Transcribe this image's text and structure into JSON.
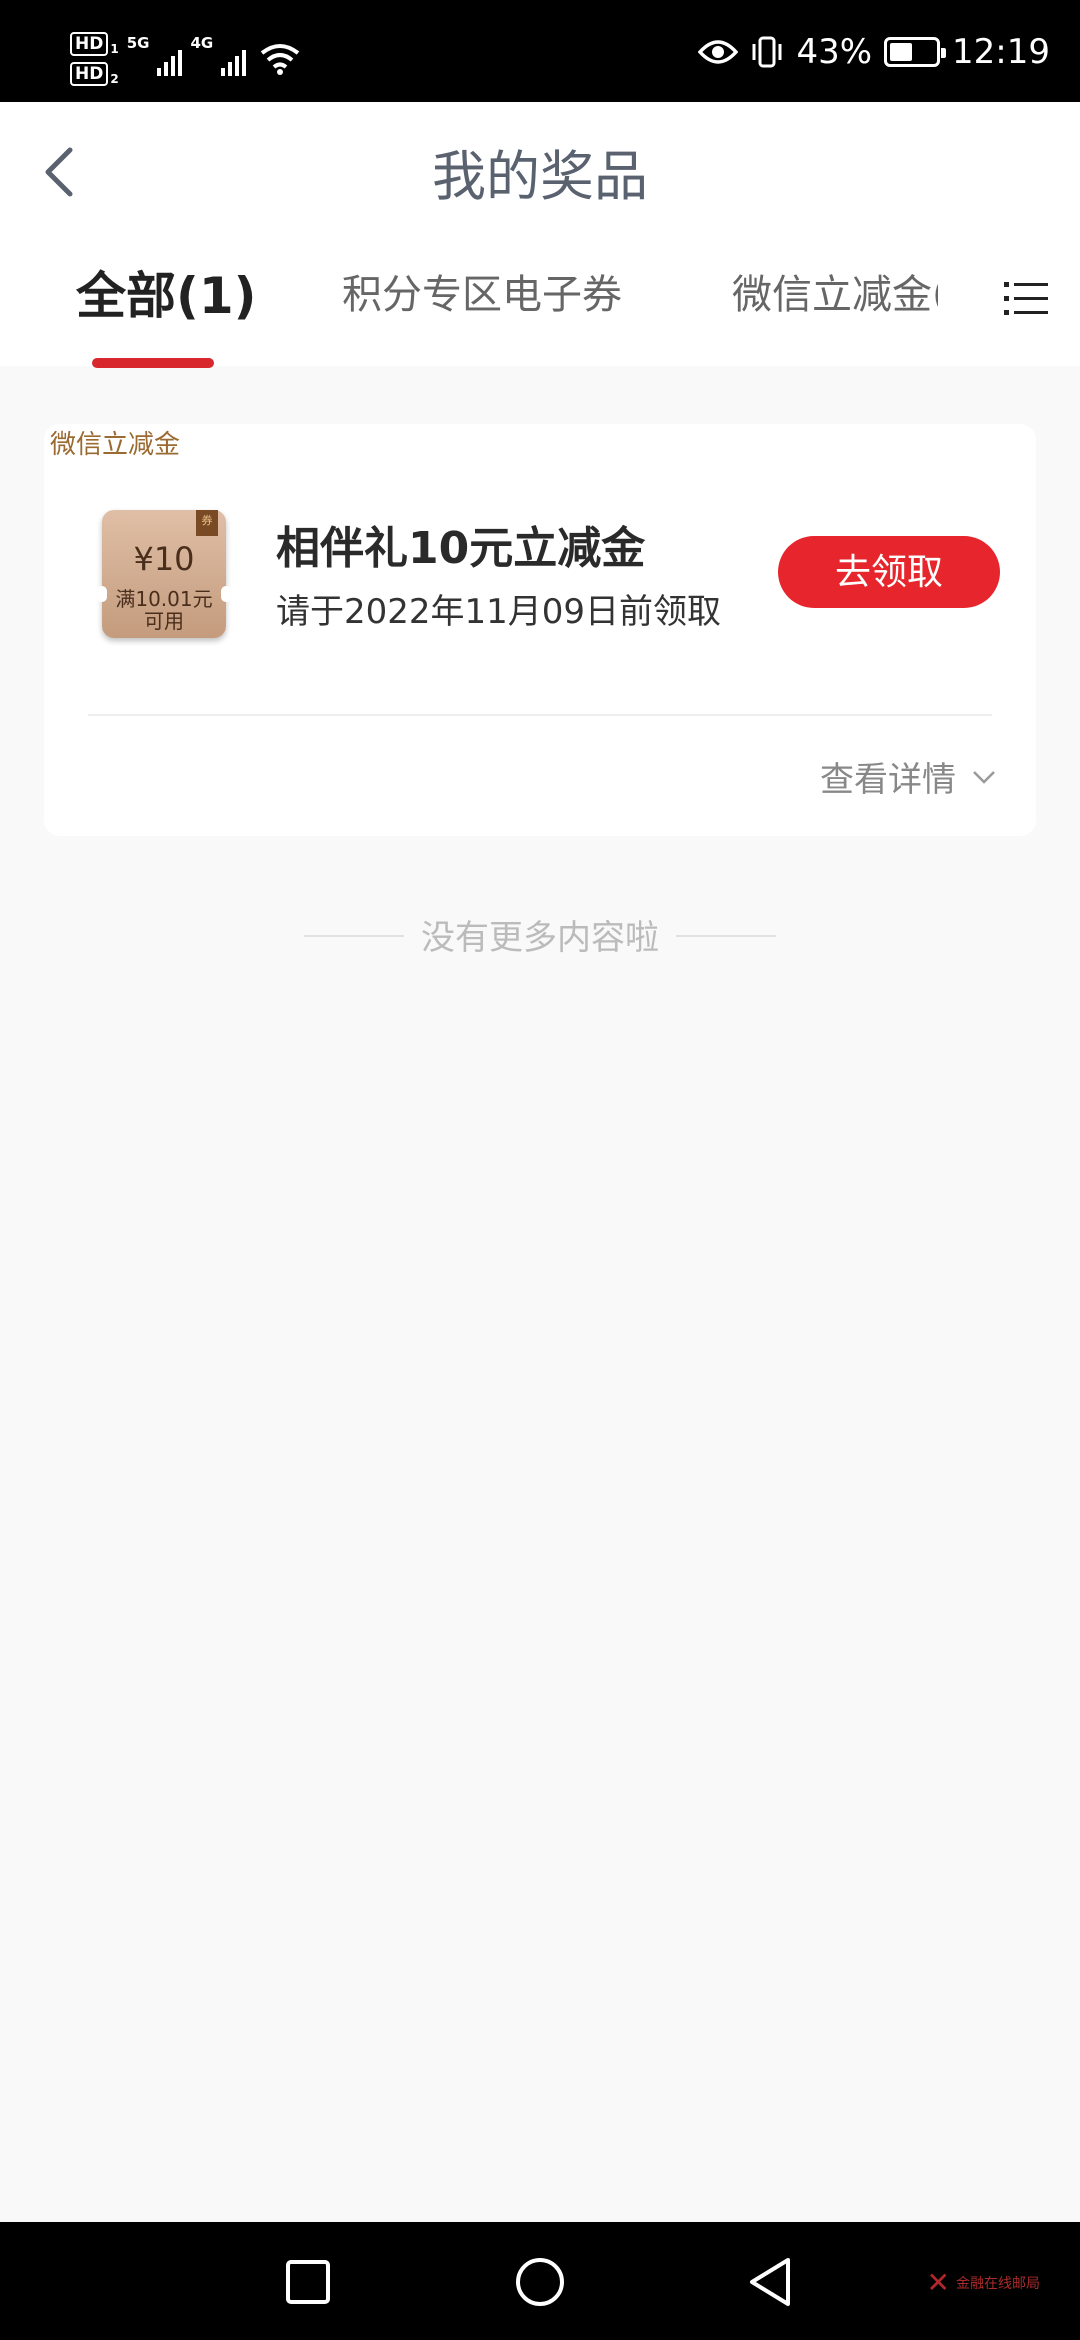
{
  "status_bar": {
    "hd1": "HD",
    "hd1_sub": "1",
    "hd2": "HD",
    "hd2_sub": "2",
    "net1": "5G",
    "net2": "4G",
    "battery_percent": "43%",
    "battery_level": 0.43,
    "time": "12:19",
    "icons": [
      "signal-icon",
      "wifi-icon",
      "eye-icon",
      "vibrate-icon",
      "battery-icon"
    ]
  },
  "header": {
    "title": "我的奖品",
    "back_icon": "chevron-left-icon",
    "menu_icon": "list-menu-icon"
  },
  "tabs": [
    {
      "label": "全部(1)",
      "active": true
    },
    {
      "label": "积分专区电子券",
      "active": false
    },
    {
      "label": "微信立减金(",
      "active": false
    }
  ],
  "prize_card": {
    "tag": "微信立减金",
    "coupon": {
      "amount": "¥10",
      "condition_line1": "满10.01元",
      "condition_line2": "可用",
      "badge": "券"
    },
    "name": "相伴礼10元立减金",
    "deadline": "请于2022年11月09日前领取",
    "claim_label": "去领取",
    "detail_label": "查看详情",
    "accent_color": "#e6262c"
  },
  "end_note": "没有更多内容啦",
  "nav_bar": {
    "buttons": [
      "recent-apps-square-icon",
      "home-circle-icon",
      "back-triangle-icon"
    ],
    "watermark_text": "金融在线邮局"
  }
}
